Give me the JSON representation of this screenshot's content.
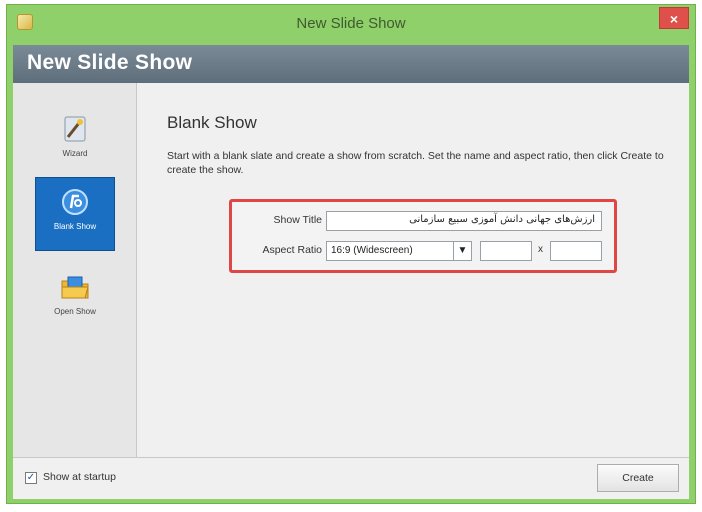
{
  "window": {
    "title": "New Slide Show",
    "close_label": "×"
  },
  "header": {
    "title": "New Slide Show"
  },
  "sidebar": {
    "items": [
      {
        "label": "Wizard",
        "icon": "wizard-icon"
      },
      {
        "label": "Blank Show",
        "icon": "blank-show-icon",
        "active": true
      },
      {
        "label": "Open Show",
        "icon": "open-show-icon"
      }
    ]
  },
  "main": {
    "section_title": "Blank Show",
    "description": "Start with a blank slate and create a show from scratch. Set the name and aspect ratio, then click Create to create the show."
  },
  "form": {
    "title_label": "Show Title",
    "title_value": "ارزش‌های جهانی دانش آموزی سبیع سازمانی",
    "ratio_label": "Aspect Ratio",
    "ratio_value": "16:9 (Widescreen)",
    "dim_separator": "x"
  },
  "footer": {
    "startup_label": "Show at startup",
    "startup_checked": true,
    "create_label": "Create"
  },
  "colors": {
    "titlebar": "#8fd06a",
    "header_band": "#66767f",
    "active_item": "#1a6fc2",
    "highlight_border": "#e04646",
    "close_button": "#e0504a"
  }
}
